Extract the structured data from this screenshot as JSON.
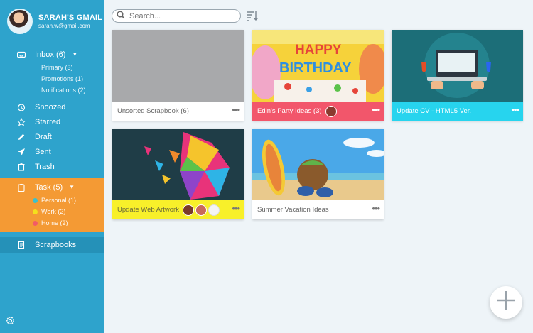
{
  "profile": {
    "name": "SARAH'S GMAIL",
    "email": "sarah.w@gmail.com"
  },
  "nav": {
    "inbox": {
      "label": "Inbox (6)",
      "subs": [
        "Primary (3)",
        "Promotions (1)",
        "Notifications (2)"
      ]
    },
    "snoozed": "Snoozed",
    "starred": "Starred",
    "draft": "Draft",
    "sent": "Sent",
    "trash": "Trash",
    "task": {
      "label": "Task (5)",
      "subs": [
        "Personal (1)",
        "Work (2)",
        "Home (2)"
      ],
      "dot_colors": [
        "#2ec4d8",
        "#f5e61b",
        "#f2566b"
      ]
    },
    "scrapbooks": "Scrapbooks"
  },
  "search": {
    "placeholder": "Search..."
  },
  "cards": [
    {
      "title": "Unsorted Scrapbook (6)",
      "footer_color": "#ffffff",
      "text_color": "#666666"
    },
    {
      "title": "Edin's Party Ideas (3)",
      "footer_color": "#f2566b",
      "text_color": "#ffffff"
    },
    {
      "title": "Update CV - HTML5 Ver.",
      "footer_color": "#27d4ee",
      "text_color": "#ffffff"
    },
    {
      "title": "Update Web Artwork",
      "footer_color": "#f8f02a",
      "text_color": "#6a6a3a"
    },
    {
      "title": "Summer Vacation Ideas",
      "footer_color": "#ffffff",
      "text_color": "#666666"
    }
  ],
  "colors": {
    "sidebar": "#2ea3cc",
    "task_highlight": "#f49a34",
    "scrapbooks_active": "#2591b8"
  },
  "icons": [
    "search-icon",
    "sort-icon",
    "inbox-icon",
    "clock-icon",
    "star-icon",
    "pencil-icon",
    "send-icon",
    "trash-icon",
    "clipboard-icon",
    "book-icon",
    "gear-icon",
    "plus-icon",
    "more-icon"
  ]
}
